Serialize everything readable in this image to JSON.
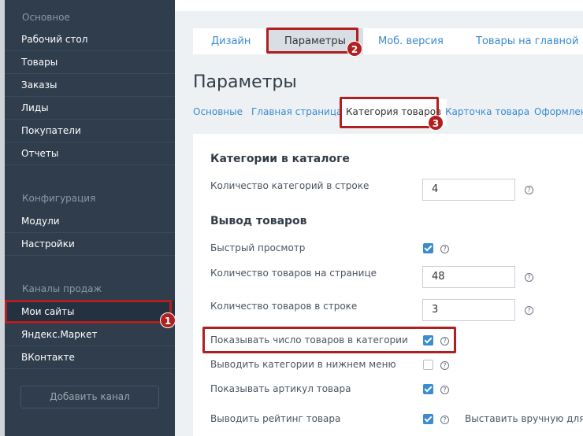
{
  "sidebar": {
    "sections": [
      "Основное",
      "Конфигурация",
      "Каналы продаж"
    ],
    "main_items": [
      "Рабочий стол",
      "Товары",
      "Заказы",
      "Лиды",
      "Покупатели",
      "Отчеты"
    ],
    "config_items": [
      "Модули",
      "Настройки"
    ],
    "channel_items": [
      "Мои сайты",
      "Яндекс.Маркет",
      "ВКонтакте"
    ],
    "active_item": "Мои сайты",
    "add_button": "Добавить канал"
  },
  "tabs": [
    "Дизайн",
    "Параметры",
    "Моб. версия",
    "Товары на главной"
  ],
  "active_tab": "Параметры",
  "page_title": "Параметры",
  "subtabs": [
    "Основные",
    "Главная страница",
    "Категория товаров",
    "Карточка товара",
    "Оформлен"
  ],
  "active_subtab": "Категория товаров",
  "catalog_section": {
    "title": "Категории в каталоге",
    "rows": [
      {
        "label": "Количество категорий в строке",
        "value": "4"
      }
    ]
  },
  "products_section": {
    "title": "Вывод товаров",
    "rows": [
      {
        "label": "Быстрый просмотр",
        "checked": true
      },
      {
        "label": "Количество товаров на странице",
        "value": "48"
      },
      {
        "label": "Количество товаров в строке",
        "value": "3"
      },
      {
        "label": "Показывать число товаров в категории",
        "checked": true
      },
      {
        "label": "Выводить категории в нижнем меню",
        "checked": false
      },
      {
        "label": "Показывать артикул товара",
        "checked": true
      },
      {
        "label": "Выводить рейтинг товара",
        "checked": true,
        "extra": "Выставить вручную для во"
      }
    ]
  },
  "help_glyph": "?",
  "annotations": [
    "1",
    "2",
    "3"
  ],
  "colors": {
    "sidebar": "#2f3d4c",
    "accent": "#3a8bd0",
    "highlight": "#b02020"
  }
}
